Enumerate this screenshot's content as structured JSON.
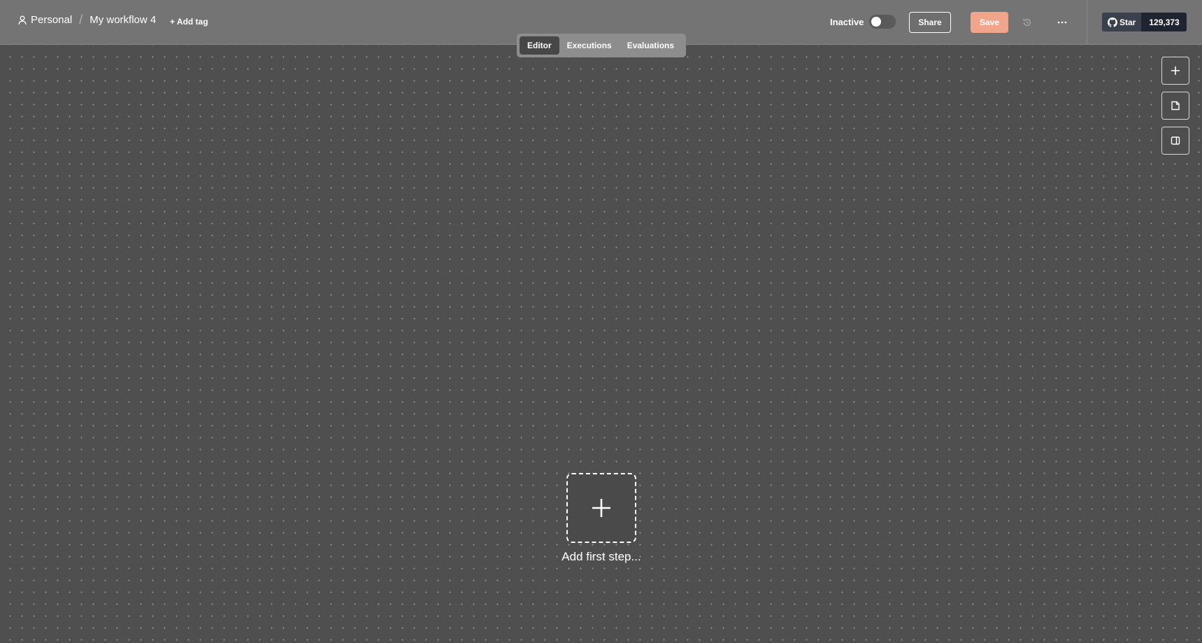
{
  "header": {
    "breadcrumb_project": "Personal",
    "breadcrumb_separator": "/",
    "workflow_name": "My workflow 4",
    "add_tag_label": "+ Add tag",
    "status_label": "Inactive",
    "active": false,
    "share_label": "Share",
    "save_label": "Save",
    "save_color": "#f2a58a",
    "more_label": "···",
    "github": {
      "star_label": "Star",
      "star_count": "129,373"
    }
  },
  "tabs": [
    {
      "label": "Editor",
      "active": true
    },
    {
      "label": "Executions",
      "active": false
    },
    {
      "label": "Evaluations",
      "active": false
    }
  ],
  "canvas": {
    "first_step_label": "Add first step..."
  },
  "side_tools": [
    {
      "icon": "plus-icon"
    },
    {
      "icon": "sticky-note-icon"
    },
    {
      "icon": "panel-toggle-icon"
    }
  ]
}
